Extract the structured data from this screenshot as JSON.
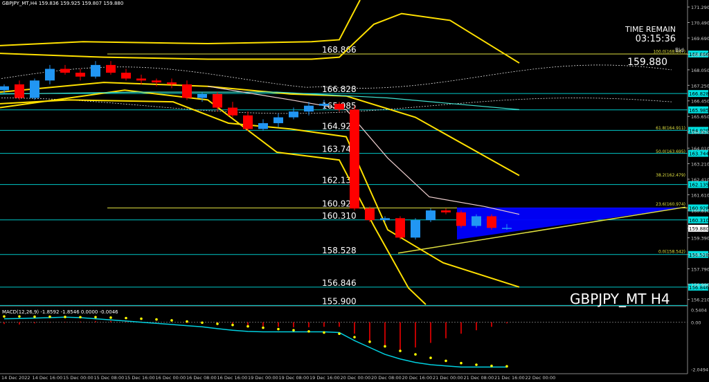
{
  "window": {
    "title": "GBPJPY_MT,H4  159.836 159.925 159.807 159.880"
  },
  "info": {
    "time_remain_label": "TIME REMAIN",
    "time_remain_value": "03:15:36",
    "bid_label": "Bid",
    "bid_value": "159.880",
    "symbol_label": "GBPJPY_MT H4"
  },
  "indicator": {
    "macd_label": "MACD(12,26,9) -1.8592 -1.8546 0.0000 -0.0046",
    "macd_ticks": [
      {
        "value": 0.5404,
        "label": "0.5404"
      },
      {
        "value": 0.0,
        "label": "0.00"
      },
      {
        "value": -2.0494,
        "label": "-2.0494"
      }
    ]
  },
  "colors": {
    "background": "#000000",
    "bull_candle": "#2196F3",
    "bear_candle": "#FF0000",
    "level_line": "#00C8C8",
    "fib_line": "#E0E040",
    "band_line": "#FFE000",
    "triangle_fill": "#0000FF",
    "price_tag": "#00E0E0",
    "macd_line": "#00D0E0",
    "macd_signal": "#FFFF00",
    "macd_hist": "#FF0000"
  },
  "price_axis": {
    "ticks": [
      "171.290",
      "170.490",
      "169.690",
      "168.850",
      "168.050",
      "167.250",
      "166.450",
      "165.650",
      "164.850",
      "164.010",
      "163.210",
      "162.410",
      "161.610",
      "160.810",
      "159.880",
      "159.390",
      "158.530",
      "157.790",
      "156.990",
      "156.210"
    ],
    "tick_values": [
      171.29,
      170.49,
      169.69,
      168.85,
      168.05,
      167.25,
      166.45,
      165.65,
      164.85,
      164.01,
      163.21,
      162.41,
      161.61,
      160.81,
      159.88,
      159.39,
      158.53,
      157.79,
      156.99,
      156.21
    ],
    "range": [
      155.95,
      171.65
    ]
  },
  "levels": [
    {
      "price": 168.866,
      "label": "168.866",
      "tag": "168.866",
      "color": "fib"
    },
    {
      "price": 166.828,
      "label": "166.828",
      "tag": "166.828",
      "color": "level"
    },
    {
      "price": 165.985,
      "label": "165.985",
      "tag": "165.985",
      "color": "level"
    },
    {
      "price": 164.929,
      "label": "164.929",
      "tag": "164.929",
      "color": "level"
    },
    {
      "price": 163.744,
      "label": "163.744",
      "tag": "163.744",
      "color": "level"
    },
    {
      "price": 162.135,
      "label": "162.135",
      "tag": "162.135",
      "color": "level"
    },
    {
      "price": 160.928,
      "label": "160.928",
      "tag": "160.928",
      "color": "fib"
    },
    {
      "price": 160.31,
      "label": "160.310",
      "tag": "160.310",
      "color": "level"
    },
    {
      "price": 158.528,
      "label": "158.528",
      "tag": "158.528",
      "color": "level"
    },
    {
      "price": 156.846,
      "label": "156.846",
      "tag": "156.846",
      "color": "level"
    },
    {
      "price": 155.9,
      "label": "155.900",
      "tag": "",
      "color": "level"
    }
  ],
  "fib_labels": [
    {
      "price": 168.847,
      "text": "100.0(168.847)"
    },
    {
      "price": 164.911,
      "text": "61.8(164.911)"
    },
    {
      "price": 163.695,
      "text": "50.0(163.695)"
    },
    {
      "price": 162.479,
      "text": "38.2(162.479)"
    },
    {
      "price": 160.974,
      "text": "23.6(160.974)"
    },
    {
      "price": 158.542,
      "text": "0.0(158.542)"
    }
  ],
  "time_axis": {
    "labels": [
      "14 Dec 2022",
      "14 Dec 16:00",
      "15 Dec 00:00",
      "15 Dec 08:00",
      "15 Dec 16:00",
      "16 Dec 00:00",
      "16 Dec 08:00",
      "16 Dec 16:00",
      "19 Dec 00:00",
      "19 Dec 08:00",
      "19 Dec 16:00",
      "20 Dec 00:00",
      "20 Dec 08:00",
      "20 Dec 16:00",
      "21 Dec 00:00",
      "21 Dec 08:00",
      "21 Dec 16:00",
      "22 Dec 00:00"
    ]
  },
  "candles": [
    {
      "o": 167.0,
      "h": 167.3,
      "l": 166.8,
      "c": 167.2
    },
    {
      "o": 167.3,
      "h": 167.5,
      "l": 166.5,
      "c": 166.6
    },
    {
      "o": 166.6,
      "h": 167.6,
      "l": 166.5,
      "c": 167.5
    },
    {
      "o": 167.5,
      "h": 168.3,
      "l": 167.3,
      "c": 168.1
    },
    {
      "o": 168.1,
      "h": 168.3,
      "l": 167.8,
      "c": 167.9
    },
    {
      "o": 167.9,
      "h": 168.1,
      "l": 167.5,
      "c": 167.7
    },
    {
      "o": 167.7,
      "h": 168.5,
      "l": 167.6,
      "c": 168.3
    },
    {
      "o": 168.3,
      "h": 168.5,
      "l": 167.8,
      "c": 167.9
    },
    {
      "o": 167.9,
      "h": 168.1,
      "l": 167.5,
      "c": 167.6
    },
    {
      "o": 167.6,
      "h": 167.8,
      "l": 167.3,
      "c": 167.5
    },
    {
      "o": 167.5,
      "h": 167.6,
      "l": 167.2,
      "c": 167.4
    },
    {
      "o": 167.4,
      "h": 167.6,
      "l": 167.1,
      "c": 167.3
    },
    {
      "o": 167.3,
      "h": 167.5,
      "l": 166.5,
      "c": 166.6
    },
    {
      "o": 166.6,
      "h": 166.9,
      "l": 166.4,
      "c": 166.8
    },
    {
      "o": 166.8,
      "h": 166.9,
      "l": 165.9,
      "c": 166.1
    },
    {
      "o": 166.1,
      "h": 166.4,
      "l": 165.6,
      "c": 165.7
    },
    {
      "o": 165.7,
      "h": 165.9,
      "l": 164.9,
      "c": 165.0
    },
    {
      "o": 165.0,
      "h": 165.5,
      "l": 164.9,
      "c": 165.3
    },
    {
      "o": 165.3,
      "h": 165.8,
      "l": 165.1,
      "c": 165.6
    },
    {
      "o": 165.6,
      "h": 166.1,
      "l": 165.5,
      "c": 165.9
    },
    {
      "o": 165.9,
      "h": 166.4,
      "l": 165.7,
      "c": 166.2
    },
    {
      "o": 166.2,
      "h": 166.5,
      "l": 166.0,
      "c": 166.3
    },
    {
      "o": 166.3,
      "h": 166.4,
      "l": 165.9,
      "c": 166.0
    },
    {
      "o": 166.0,
      "h": 166.2,
      "l": 160.8,
      "c": 160.9
    },
    {
      "o": 160.9,
      "h": 161.0,
      "l": 160.2,
      "c": 160.3
    },
    {
      "o": 160.3,
      "h": 160.5,
      "l": 160.2,
      "c": 160.4
    },
    {
      "o": 160.4,
      "h": 160.5,
      "l": 159.3,
      "c": 159.4
    },
    {
      "o": 159.4,
      "h": 160.4,
      "l": 159.3,
      "c": 160.3
    },
    {
      "o": 160.3,
      "h": 160.9,
      "l": 160.2,
      "c": 160.8
    },
    {
      "o": 160.8,
      "h": 160.9,
      "l": 160.6,
      "c": 160.7
    },
    {
      "o": 160.7,
      "h": 160.8,
      "l": 159.9,
      "c": 160.0
    },
    {
      "o": 160.0,
      "h": 160.6,
      "l": 159.9,
      "c": 160.5
    },
    {
      "o": 160.5,
      "h": 160.6,
      "l": 159.8,
      "c": 159.9
    },
    {
      "o": 159.9,
      "h": 160.1,
      "l": 159.8,
      "c": 159.9
    }
  ],
  "macd": {
    "range": [
      -2.15,
      0.62
    ],
    "hist": [
      -0.08,
      -0.1,
      -0.05,
      -0.02,
      0.02,
      0.03,
      0.05,
      0.06,
      0.05,
      0.03,
      0.02,
      0.0,
      -0.03,
      -0.05,
      -0.08,
      -0.12,
      -0.15,
      -0.18,
      -0.2,
      -0.22,
      -0.22,
      -0.2,
      -0.2,
      -0.5,
      -0.8,
      -1.0,
      -1.2,
      -1.1,
      -0.9,
      -0.7,
      -0.5,
      -0.35,
      -0.2,
      -0.05
    ],
    "signal": [
      0.25,
      0.25,
      0.24,
      0.24,
      0.23,
      0.22,
      0.22,
      0.2,
      0.18,
      0.15,
      0.12,
      0.08,
      0.03,
      -0.02,
      -0.07,
      -0.12,
      -0.18,
      -0.24,
      -0.3,
      -0.35,
      -0.4,
      -0.45,
      -0.5,
      -0.65,
      -0.85,
      -1.05,
      -1.25,
      -1.4,
      -1.55,
      -1.68,
      -1.78,
      -1.85,
      -1.9,
      -1.92
    ],
    "line": [
      0.15,
      0.16,
      0.18,
      0.2,
      0.22,
      0.2,
      0.15,
      0.1,
      0.05,
      0.0,
      -0.05,
      -0.1,
      -0.15,
      -0.2,
      -0.28,
      -0.35,
      -0.4,
      -0.42,
      -0.42,
      -0.42,
      -0.42,
      -0.42,
      -0.45,
      -0.8,
      -1.1,
      -1.4,
      -1.6,
      -1.75,
      -1.85,
      -1.9,
      -1.95,
      -1.95,
      -1.95,
      -1.95
    ]
  }
}
